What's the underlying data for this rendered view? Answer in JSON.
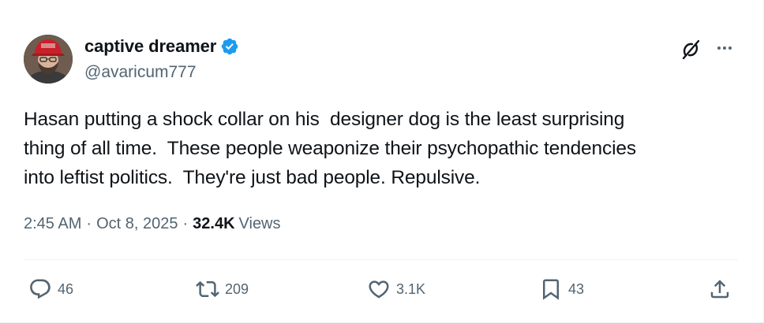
{
  "author": {
    "display_name": "captive dreamer",
    "handle": "@avaricum777",
    "verified": true,
    "verified_color": "#1d9bf0"
  },
  "tweet": {
    "text": "Hasan putting a shock collar on his  designer dog is the least surprising\nthing of all time.  These people weaponize their psychopathic tendencies\ninto leftist politics.  They're just bad people. Repulsive."
  },
  "meta": {
    "time": "2:45 AM",
    "separator": "·",
    "date": "Oct 8, 2025",
    "views_count": "32.4K",
    "views_label": "Views"
  },
  "actions": {
    "replies": "46",
    "reposts": "209",
    "likes": "3.1K",
    "bookmarks": "43"
  },
  "icons": {
    "grok": "grok-icon",
    "more": "more-dots-icon",
    "reply": "reply-icon",
    "repost": "repost-icon",
    "like": "heart-icon",
    "bookmark": "bookmark-icon",
    "share": "share-icon"
  },
  "colors": {
    "text_primary": "#0f1419",
    "text_secondary": "#536471",
    "border": "#eff3f4",
    "avatar_hat": "#c8202a"
  }
}
